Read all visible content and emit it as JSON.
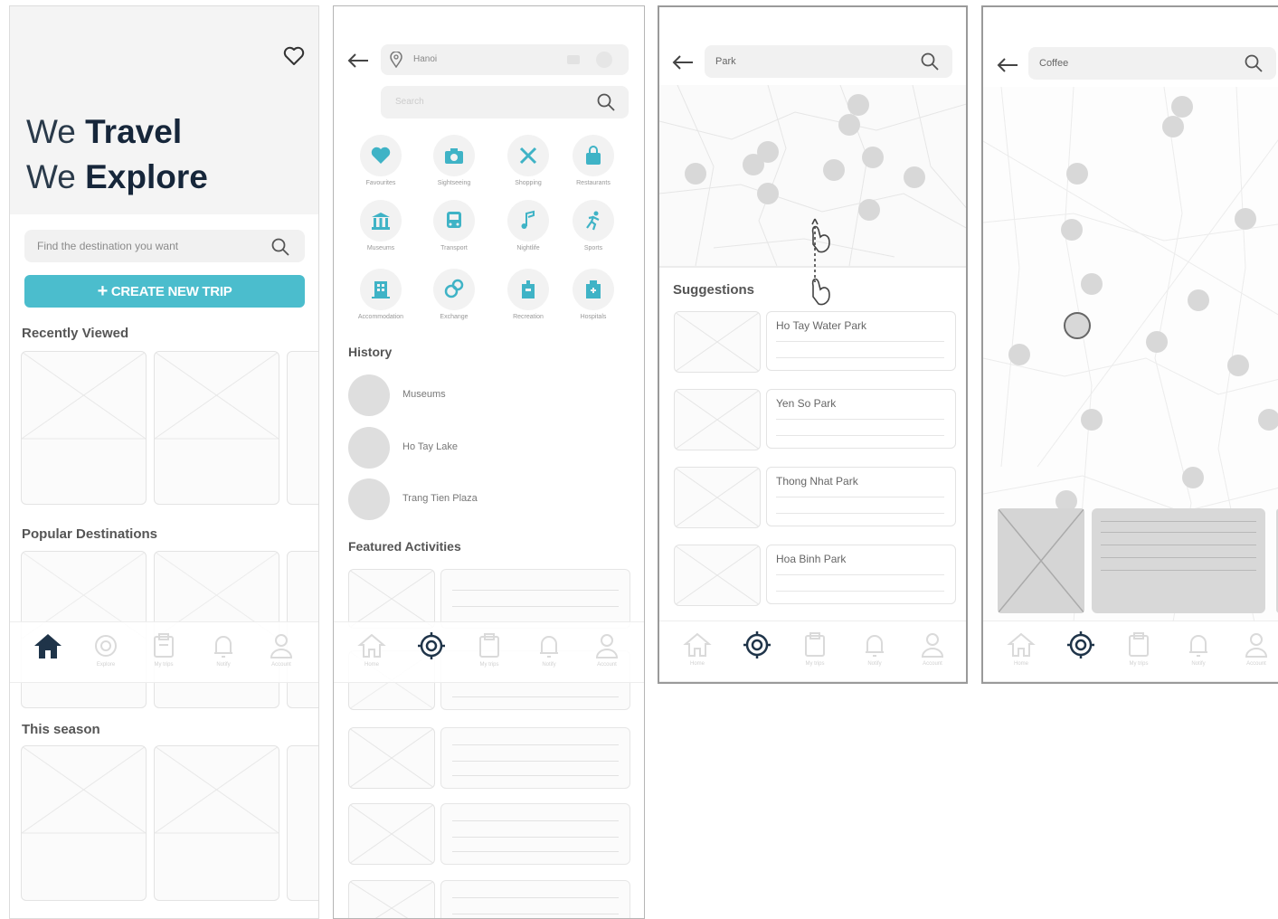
{
  "colors": {
    "accent": "#4bbdcd",
    "nav_active": "#2c3e50",
    "placeholder": "#e3e3e3"
  },
  "screen_home": {
    "headline_line1_prefix": "We",
    "headline_line1_bold": "Travel",
    "headline_line2_prefix": "We",
    "headline_line2_bold": "Explore",
    "search_placeholder": "Find the destination you want",
    "create_button": "CREATE NEW TRIP",
    "sections": [
      "Recently Viewed",
      "Popular Destinations",
      "This season"
    ]
  },
  "bottom_nav": {
    "items": [
      {
        "icon": "home-icon",
        "label": "Home"
      },
      {
        "icon": "explore-icon",
        "label": "Explore"
      },
      {
        "icon": "trips-icon",
        "label": "My trips"
      },
      {
        "icon": "bell-icon",
        "label": "Notify"
      },
      {
        "icon": "user-icon",
        "label": "Account"
      }
    ]
  },
  "screen_explore": {
    "location_value": "Hanoi",
    "search_placeholder": "Search",
    "categories": [
      {
        "icon": "heart-icon",
        "label": "Favourites"
      },
      {
        "icon": "camera-icon",
        "label": "Sightseeing"
      },
      {
        "icon": "tools-icon",
        "label": "Shopping"
      },
      {
        "icon": "bag-icon",
        "label": "Restaurants"
      },
      {
        "icon": "museum-icon",
        "label": "Museums"
      },
      {
        "icon": "bus-icon",
        "label": "Transport"
      },
      {
        "icon": "music-icon",
        "label": "Nightlife"
      },
      {
        "icon": "sport-icon",
        "label": "Sports"
      },
      {
        "icon": "hotel-icon",
        "label": "Accommodation"
      },
      {
        "icon": "exchange-icon",
        "label": "Exchange"
      },
      {
        "icon": "recreation-icon",
        "label": "Recreation"
      },
      {
        "icon": "hospital-icon",
        "label": "Hospitals"
      }
    ],
    "history_title": "History",
    "history": [
      "Museums",
      "Ho Tay Lake",
      "Trang Tien Plaza"
    ],
    "featured_title": "Featured Activities"
  },
  "screen_park": {
    "search_value": "Park",
    "suggestions_title": "Suggestions",
    "suggestions": [
      "Ho Tay Water Park",
      "Yen So Park",
      "Thong Nhat Park",
      "Hoa Binh Park"
    ]
  },
  "screen_coffee": {
    "search_value": "Coffee"
  }
}
